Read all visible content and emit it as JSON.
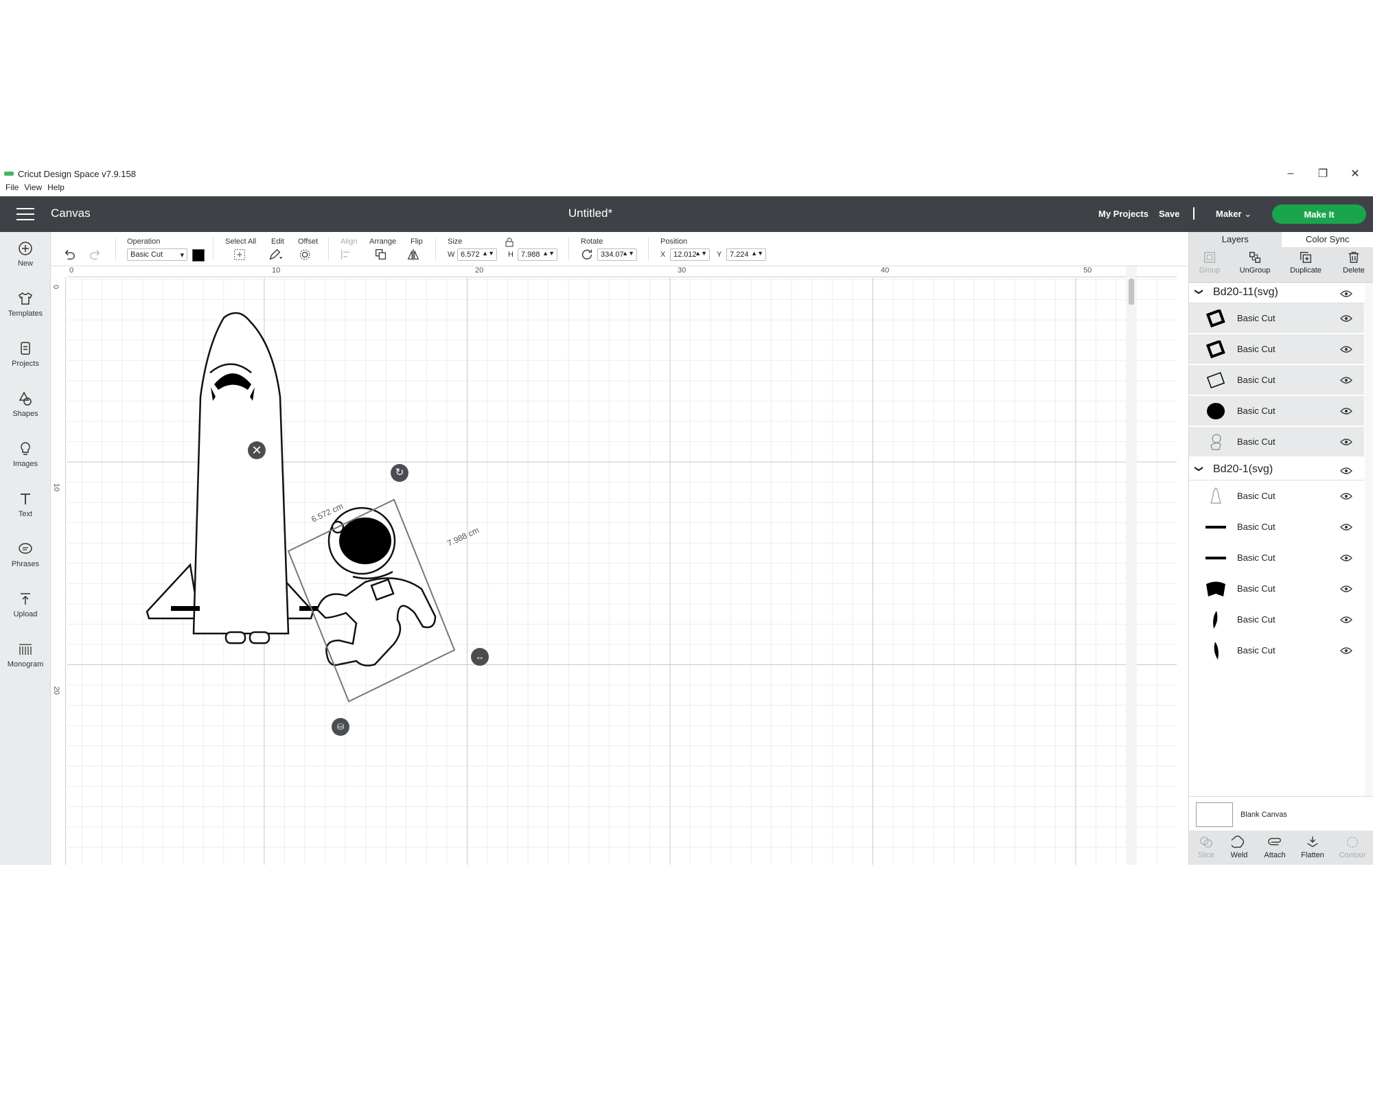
{
  "window": {
    "title": "Cricut Design Space  v7.9.158",
    "menu": [
      "File",
      "View",
      "Help"
    ]
  },
  "header": {
    "section": "Canvas",
    "document_title": "Untitled*",
    "my_projects": "My Projects",
    "save": "Save",
    "machine": "Maker",
    "make_it": "Make It",
    "accent_color": "#1aa54c",
    "bar_color": "#3e4246"
  },
  "sidebar": {
    "items": [
      {
        "label": "New",
        "icon": "plus-circle-icon"
      },
      {
        "label": "Templates",
        "icon": "tshirt-icon"
      },
      {
        "label": "Projects",
        "icon": "projects-icon"
      },
      {
        "label": "Shapes",
        "icon": "shapes-icon"
      },
      {
        "label": "Images",
        "icon": "lightbulb-icon"
      },
      {
        "label": "Text",
        "icon": "text-icon"
      },
      {
        "label": "Phrases",
        "icon": "speech-bubble-icon"
      },
      {
        "label": "Upload",
        "icon": "upload-icon"
      },
      {
        "label": "Monogram",
        "icon": "monogram-icon"
      }
    ]
  },
  "toolbar": {
    "operation_label": "Operation",
    "operation_value": "Basic Cut",
    "operation_color": "#000000",
    "select_all": "Select All",
    "edit": "Edit",
    "offset": "Offset",
    "align": "Align",
    "arrange": "Arrange",
    "flip": "Flip",
    "size_label": "Size",
    "w_label": "W",
    "w_value": "6.572",
    "h_label": "H",
    "h_value": "7.988",
    "rotate_label": "Rotate",
    "rotate_value": "334.07",
    "position_label": "Position",
    "x_label": "X",
    "x_value": "12.012",
    "y_label": "Y",
    "y_value": "7.224"
  },
  "canvas": {
    "ruler_top": [
      "0",
      "10",
      "20",
      "30",
      "40",
      "50"
    ],
    "ruler_left": [
      "0",
      "10",
      "20"
    ],
    "selection_width": "6.572 cm",
    "selection_height": "7.988 cm"
  },
  "right_panel": {
    "tabs": [
      "Layers",
      "Color Sync"
    ],
    "tools": [
      "Group",
      "UnGroup",
      "Duplicate",
      "Delete"
    ],
    "groups": [
      {
        "name": "Bd20-11(svg)",
        "layers": [
          {
            "label": "Basic Cut",
            "thumb": "frame-thick"
          },
          {
            "label": "Basic Cut",
            "thumb": "frame-thick"
          },
          {
            "label": "Basic Cut",
            "thumb": "frame-thin"
          },
          {
            "label": "Basic Cut",
            "thumb": "blob"
          },
          {
            "label": "Basic Cut",
            "thumb": "astronaut"
          }
        ]
      },
      {
        "name": "Bd20-1(svg)",
        "layers": [
          {
            "label": "Basic Cut",
            "thumb": "rocket"
          },
          {
            "label": "Basic Cut",
            "thumb": "bar"
          },
          {
            "label": "Basic Cut",
            "thumb": "bar"
          },
          {
            "label": "Basic Cut",
            "thumb": "arch"
          },
          {
            "label": "Basic Cut",
            "thumb": "leaf"
          },
          {
            "label": "Basic Cut",
            "thumb": "leaf"
          }
        ]
      }
    ],
    "blank_canvas": "Blank Canvas",
    "bottom_tools": [
      "Slice",
      "Weld",
      "Attach",
      "Flatten",
      "Contour"
    ]
  }
}
